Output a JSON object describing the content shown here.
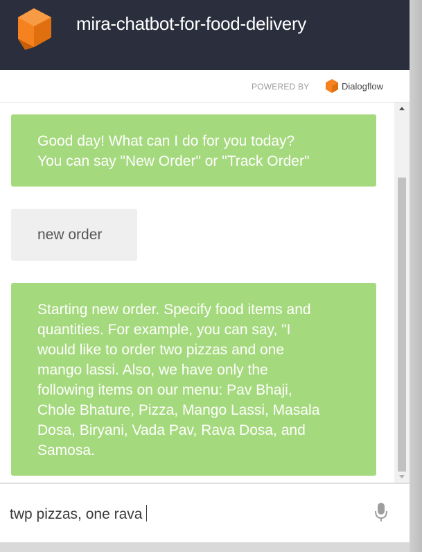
{
  "header": {
    "title": "mira-chatbot-for-food-delivery",
    "logo_icon": "orange-cube-logo-icon"
  },
  "powered_by": {
    "label": "POWERED BY",
    "brand": "Dialogflow",
    "brand_icon": "dialogflow-icon"
  },
  "messages": [
    {
      "sender": "bot",
      "lines": [
        "Good day! What can I do for you today?",
        "You can say \"New Order\" or \"Track Order\""
      ]
    },
    {
      "sender": "user",
      "text": "new order"
    },
    {
      "sender": "bot",
      "lines": [
        "Starting new order. Specify food items and",
        "quantities. For example, you can say, \"I",
        "would like to order two pizzas and one",
        "mango lassi. Also, we have only the",
        "following items on our menu: Pav Bhaji,",
        "Chole Bhature, Pizza, Mango Lassi, Masala",
        "Dosa, Biryani, Vada Pav, Rava Dosa, and",
        "Samosa."
      ]
    }
  ],
  "input": {
    "value": "twp pizzas, one rava",
    "mic_icon": "microphone-icon"
  },
  "colors": {
    "header_bg": "#2b2f3d",
    "bot_bubble": "#a5d97d",
    "user_bubble": "#efeff0",
    "logo_orange": "#f5821f"
  }
}
